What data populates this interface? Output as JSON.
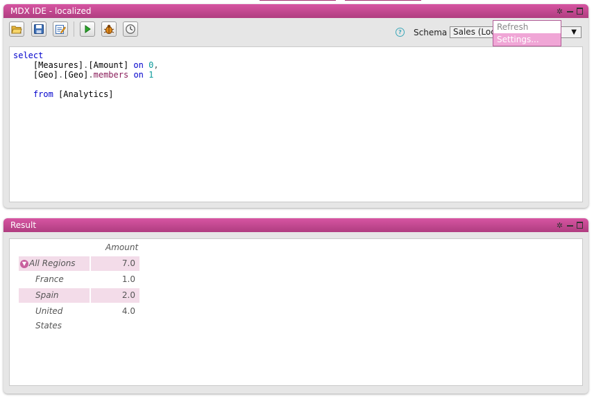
{
  "ide_panel": {
    "title": "MDX IDE - localized",
    "toolbar": {
      "buttons": [
        {
          "name": "open-folder-icon"
        },
        {
          "name": "save-icon"
        },
        {
          "name": "edit-icon"
        },
        {
          "name": "run-icon"
        },
        {
          "name": "debug-icon"
        },
        {
          "name": "history-icon"
        }
      ]
    },
    "schema_label": "Schema",
    "schema_value": "Sales (Localized)",
    "schema_menu": {
      "items": [
        {
          "label": "Refresh"
        },
        {
          "label": "Settings..."
        }
      ],
      "highlighted": 1
    },
    "editor_lines": [
      "select",
      "    [Measures].[Amount] on 0,",
      "    [Geo].[Geo].members on 1",
      "",
      "    from [Analytics]"
    ]
  },
  "result_panel": {
    "title": "Result",
    "column_header": "Amount",
    "rows": [
      {
        "label": "All Regions",
        "value": "7.0",
        "collapsible": true
      },
      {
        "label": "France",
        "value": "1.0"
      },
      {
        "label": "Spain",
        "value": "2.0"
      },
      {
        "label": "United States",
        "value": "4.0"
      }
    ]
  },
  "colors": {
    "accent": "#c44c92",
    "row_highlight": "#f3dce9",
    "menu_highlight": "#f0a6d6"
  }
}
